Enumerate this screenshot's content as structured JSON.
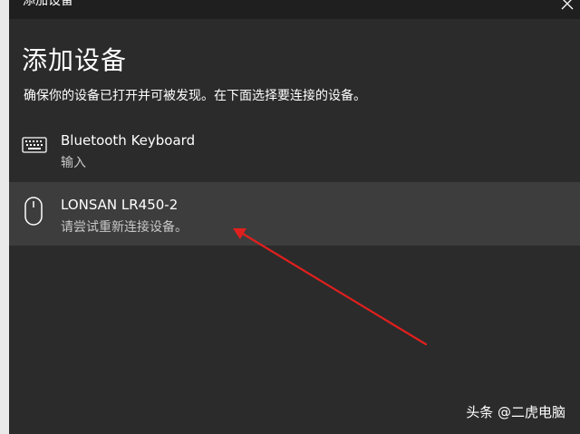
{
  "window": {
    "title": "添加设备"
  },
  "heading": "添加设备",
  "subtitle": "确保你的设备已打开并可被发现。在下面选择要连接的设备。",
  "devices": [
    {
      "name": "Bluetooth Keyboard",
      "status": "输入",
      "icon": "keyboard-icon"
    },
    {
      "name": "LONSAN LR450-2",
      "status": "请尝试重新连接设备。",
      "icon": "mouse-icon"
    }
  ],
  "watermark": "头条 @二虎电脑",
  "colors": {
    "background": "#2b2b2b",
    "selected_row": "#3d3d3d",
    "annotation_arrow": "#e0201e"
  }
}
